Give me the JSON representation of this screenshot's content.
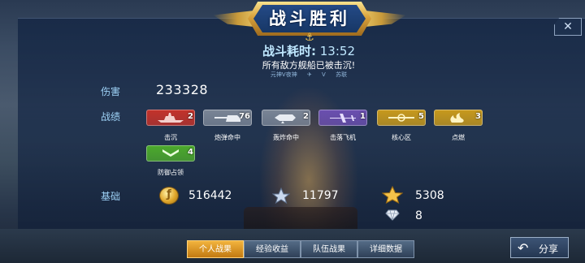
{
  "header": {
    "title": "战斗胜利",
    "close_symbol": "✕",
    "time_label": "战斗耗时:",
    "time_value": "13:52",
    "subtitle": "所有敌方舰船已被击沉!",
    "player_left": "元神V夜神",
    "player_icon": "✈",
    "player_mid": "V",
    "player_right": "苏联"
  },
  "damage": {
    "label": "伤害",
    "value": "233328"
  },
  "achievements": {
    "label": "战绩",
    "badges": [
      {
        "label": "击沉",
        "count": "2",
        "color": "#c4322a",
        "icon": "ship-silhouette-icon"
      },
      {
        "label": "炮弹命中",
        "count": "76",
        "color": "#7a8596",
        "icon": "gun-turret-icon"
      },
      {
        "label": "轰炸命中",
        "count": "2",
        "color": "#7a8596",
        "icon": "bomb-icon"
      },
      {
        "label": "击落飞机",
        "count": "1",
        "color": "#6b4fb0",
        "icon": "plane-icon"
      },
      {
        "label": "核心区",
        "count": "5",
        "color": "#c89a1c",
        "icon": "core-target-icon"
      },
      {
        "label": "点燃",
        "count": "3",
        "color": "#c89a1c",
        "icon": "fire-icon"
      },
      {
        "label": "防御占领",
        "count": "4",
        "color": "#4caa2c",
        "icon": "shield-chevron-icon"
      }
    ]
  },
  "base": {
    "label": "基础",
    "coins": "516442",
    "exp": "11797",
    "rank_points": "5308",
    "diamonds": "8"
  },
  "tabs": [
    "个人战果",
    "经验收益",
    "队伍战果",
    "详细数据"
  ],
  "active_tab": 0,
  "share_label": "分享"
}
